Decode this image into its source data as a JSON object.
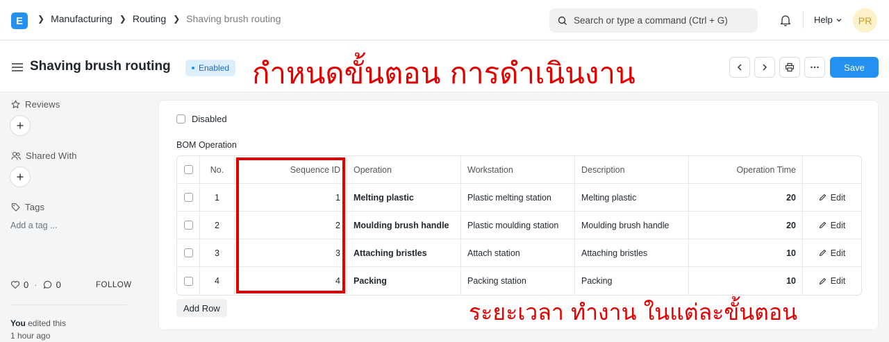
{
  "navbar": {
    "logo_letter": "E",
    "breadcrumbs": [
      "Manufacturing",
      "Routing",
      "Shaving brush routing"
    ],
    "search_placeholder": "Search or type a command (Ctrl + G)",
    "help_label": "Help",
    "avatar_initials": "PR"
  },
  "page": {
    "title": "Shaving brush routing",
    "status": "Enabled",
    "save_label": "Save"
  },
  "sidebar": {
    "reviews_label": "Reviews",
    "shared_label": "Shared With",
    "tags_label": "Tags",
    "add_tag": "Add a tag ...",
    "likes": "0",
    "comments": "0",
    "follow": "FOLLOW",
    "activity_user": "You",
    "activity_text": "edited this",
    "activity_time": "1 hour ago"
  },
  "form": {
    "disabled_label": "Disabled",
    "section_label": "BOM Operation",
    "add_row_label": "Add Row",
    "columns": [
      "No.",
      "Sequence ID",
      "Operation",
      "Workstation",
      "Description",
      "Operation Time"
    ],
    "edit_label": "Edit",
    "rows": [
      {
        "no": "1",
        "seq": "1",
        "operation": "Melting plastic",
        "workstation": "Plastic melting station",
        "description": "Melting plastic",
        "time": "20"
      },
      {
        "no": "2",
        "seq": "2",
        "operation": "Moulding brush handle",
        "workstation": "Plastic moulding station",
        "description": "Moulding brush handle",
        "time": "20"
      },
      {
        "no": "3",
        "seq": "3",
        "operation": "Attaching bristles",
        "workstation": "Attach station",
        "description": "Attaching bristles",
        "time": "10"
      },
      {
        "no": "4",
        "seq": "4",
        "operation": "Packing",
        "workstation": "Packing station",
        "description": "Packing",
        "time": "10"
      }
    ]
  },
  "annotations": {
    "title": "กำหนดขั้นตอน การดำเนินงาน",
    "bottom": "ระยะเวลา ทำงาน  ในแต่ละขั้นตอน"
  },
  "colors": {
    "accent": "#2490ef",
    "annotation": "#e10000"
  }
}
